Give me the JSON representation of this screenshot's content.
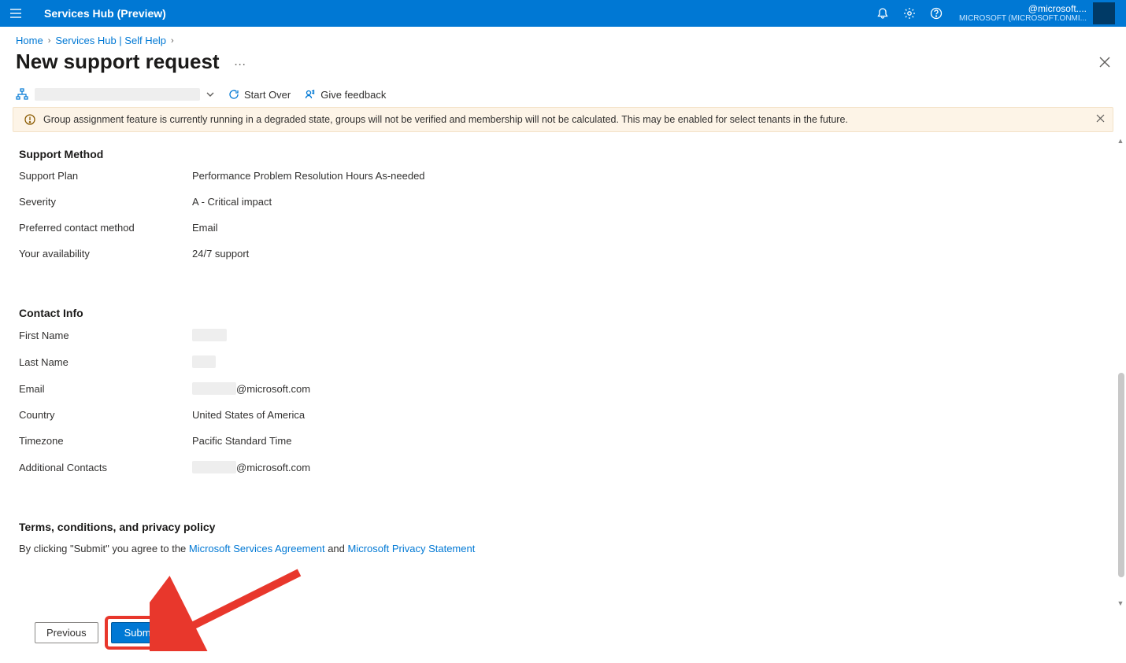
{
  "header": {
    "app_title": "Services Hub (Preview)",
    "account_email": "@microsoft....",
    "account_tenant": "MICROSOFT (MICROSOFT.ONMI..."
  },
  "breadcrumb": {
    "home": "Home",
    "self_help": "Services Hub | Self Help"
  },
  "page": {
    "title": "New support request"
  },
  "commands": {
    "start_over": "Start Over",
    "give_feedback": "Give feedback"
  },
  "banner": {
    "message": "Group assignment feature is currently running in a degraded state, groups will not be verified and membership will not be calculated. This may be enabled for select tenants in the future."
  },
  "sections": {
    "support_method": {
      "header": "Support Method",
      "support_plan": {
        "label": "Support Plan",
        "value": "Performance Problem Resolution Hours As-needed"
      },
      "severity": {
        "label": "Severity",
        "value": "A - Critical impact"
      },
      "preferred_contact": {
        "label": "Preferred contact method",
        "value": "Email"
      },
      "availability": {
        "label": "Your availability",
        "value": "24/7 support"
      }
    },
    "contact_info": {
      "header": "Contact Info",
      "first_name": {
        "label": "First Name"
      },
      "last_name": {
        "label": "Last Name"
      },
      "email": {
        "label": "Email",
        "suffix": "@microsoft.com"
      },
      "country": {
        "label": "Country",
        "value": "United States of America"
      },
      "timezone": {
        "label": "Timezone",
        "value": "Pacific Standard Time"
      },
      "additional": {
        "label": "Additional Contacts",
        "suffix": "@microsoft.com"
      }
    },
    "terms": {
      "header": "Terms, conditions, and privacy policy",
      "prefix": "By clicking \"Submit\" you agree to the ",
      "msa": "Microsoft Services Agreement",
      "and": " and ",
      "privacy": "Microsoft Privacy Statement"
    }
  },
  "footer": {
    "previous": "Previous",
    "submit": "Submit"
  }
}
